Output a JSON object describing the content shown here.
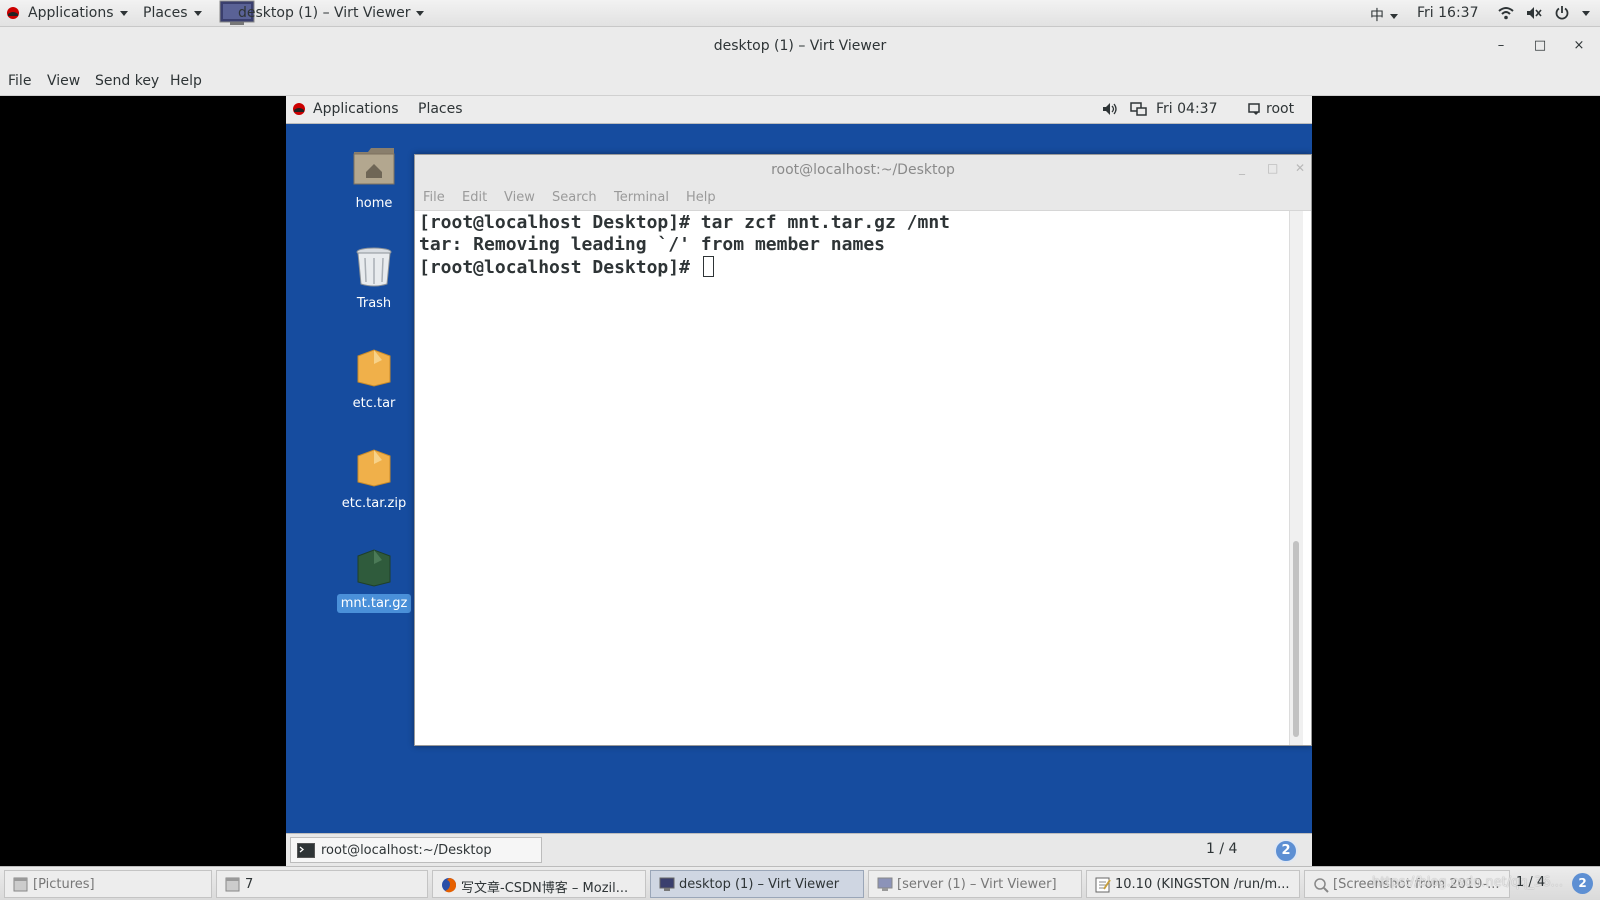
{
  "host_panel": {
    "applications": "Applications",
    "places": "Places",
    "active_window": "desktop (1) – Virt Viewer",
    "input_method": "中",
    "clock": "Fri 16:37"
  },
  "viewer": {
    "title": "desktop (1) – Virt Viewer",
    "minimize": "–",
    "maximize": "□",
    "close": "×",
    "menu": {
      "file": "File",
      "view": "View",
      "send_key": "Send key",
      "help": "Help"
    }
  },
  "guest_panel": {
    "applications": "Applications",
    "places": "Places",
    "clock": "Fri 04:37",
    "user": "root"
  },
  "desktop_icons": [
    {
      "label": "home",
      "icon": "folder-home-icon"
    },
    {
      "label": "Trash",
      "icon": "trash-icon"
    },
    {
      "label": "etc.tar",
      "icon": "archive-icon"
    },
    {
      "label": "etc.tar.zip",
      "icon": "archive-icon"
    },
    {
      "label": "mnt.tar.gz",
      "icon": "archive-gz-icon",
      "selected": true
    }
  ],
  "terminal": {
    "title": "root@localhost:~/Desktop",
    "menu": {
      "file": "File",
      "edit": "Edit",
      "view": "View",
      "search": "Search",
      "terminal": "Terminal",
      "help": "Help"
    },
    "lines": [
      "[root@localhost Desktop]# tar zcf mnt.tar.gz /mnt",
      "tar: Removing leading `/' from member names",
      "[root@localhost Desktop]# "
    ]
  },
  "guest_taskbar": {
    "task": "root@localhost:~/Desktop",
    "workspace": "1 / 4",
    "badge": "2"
  },
  "host_taskbar": {
    "tasks": [
      {
        "label": "[Pictures]"
      },
      {
        "label": "7"
      },
      {
        "label": "写文章-CSDN博客 – Mozil..."
      },
      {
        "label": "desktop (1) – Virt Viewer",
        "active": true
      },
      {
        "label": "[server (1) – Virt Viewer]"
      },
      {
        "label": "10.10 (KINGSTON /run/m..."
      },
      {
        "label": "[Screenshot from 2019-..."
      }
    ],
    "pager": "1 / 4",
    "badge": "2",
    "watermark": "https://blog.csdn.net/qq_36..."
  },
  "colors": {
    "guest_desktop": "#164c9f",
    "selection": "#4a90d9",
    "panel": "#ececec"
  }
}
